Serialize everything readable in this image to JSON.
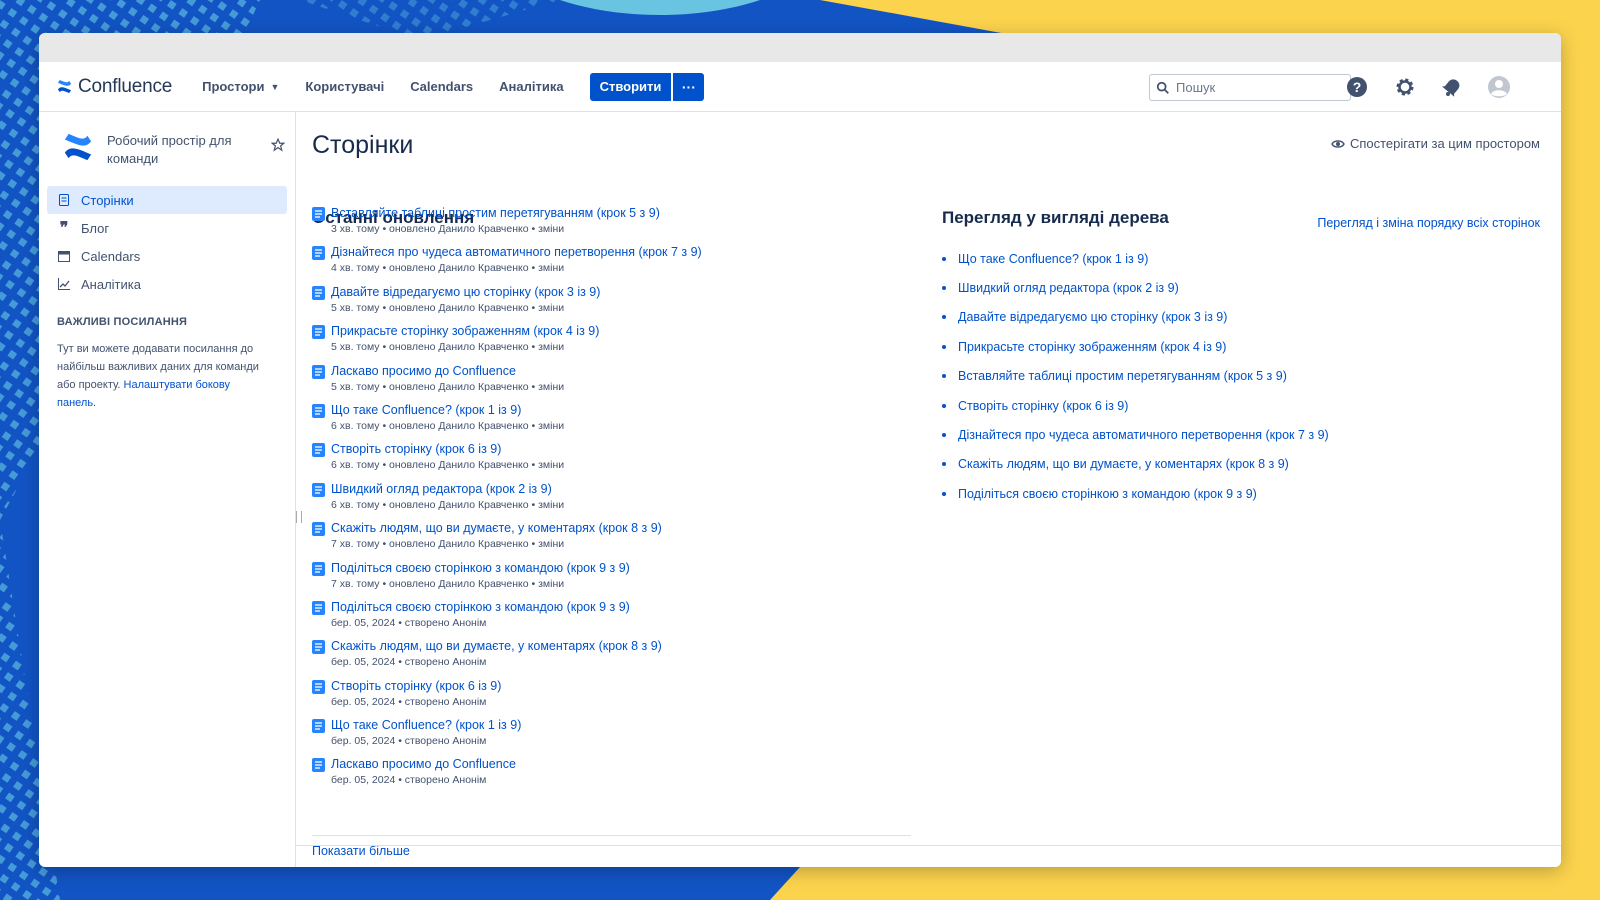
{
  "app": {
    "name": "Confluence",
    "accent_color": "#0052cc",
    "nav": {
      "spaces": "Простори",
      "people": "Користувачі",
      "calendars": "Calendars",
      "analytics": "Аналітика",
      "create": "Створити",
      "more": "···"
    },
    "search_placeholder": "Пошук",
    "icons": [
      "help-icon",
      "settings-icon",
      "notifications-icon",
      "user-avatar-icon"
    ]
  },
  "sidebar": {
    "space_name": "Робочий простір для команди",
    "items": [
      {
        "label": "Сторінки",
        "icon": "page-icon",
        "active": true
      },
      {
        "label": "Блог",
        "icon": "quote-icon",
        "active": false
      },
      {
        "label": "Calendars",
        "icon": "calendar-icon",
        "active": false
      },
      {
        "label": "Аналітика",
        "icon": "chart-icon",
        "active": false
      }
    ],
    "links_title": "ВАЖЛИВІ ПОСИЛАННЯ",
    "links_text": "Тут ви можете додавати посилання до найбільш важливих даних для команди або проекту.",
    "links_action": "Налаштувати бокову панель."
  },
  "main": {
    "title": "Сторінки",
    "watch_label": "Спостерігати за цим простором",
    "recent_title": "Останні оновлення",
    "tree_title": "Перегляд у вигляді дерева",
    "tree_all_link": "Перегляд і зміна порядку всіх сторінок",
    "show_more": "Показати більше",
    "recent": [
      {
        "title": "Вставляйте таблиці простим перетягуванням (крок 5 з 9)",
        "meta": "3 хв. тому • оновлено Данило Кравченко • зміни"
      },
      {
        "title": "Дізнайтеся про чудеса автоматичного перетворення (крок 7 з 9)",
        "meta": "4 хв. тому • оновлено Данило Кравченко • зміни"
      },
      {
        "title": "Давайте відредагуємо цю сторінку (крок 3 із 9)",
        "meta": "5 хв. тому • оновлено Данило Кравченко • зміни"
      },
      {
        "title": "Прикрасьте сторінку зображенням (крок 4 із 9)",
        "meta": "5 хв. тому • оновлено Данило Кравченко • зміни"
      },
      {
        "title": "Ласкаво просимо до Confluence",
        "meta": "5 хв. тому • оновлено Данило Кравченко • зміни"
      },
      {
        "title": "Що таке Confluence? (крок 1 із 9)",
        "meta": "6 хв. тому • оновлено Данило Кравченко • зміни"
      },
      {
        "title": "Створіть сторінку (крок 6 із 9)",
        "meta": "6 хв. тому • оновлено Данило Кравченко • зміни"
      },
      {
        "title": "Швидкий огляд редактора (крок 2 із 9)",
        "meta": "6 хв. тому • оновлено Данило Кравченко • зміни"
      },
      {
        "title": "Скажіть людям, що ви думаєте, у коментарях (крок 8 з 9)",
        "meta": "7 хв. тому • оновлено Данило Кравченко • зміни"
      },
      {
        "title": "Поділіться своєю сторінкою з командою (крок 9 з 9)",
        "meta": "7 хв. тому • оновлено Данило Кравченко • зміни"
      },
      {
        "title": "Поділіться своєю сторінкою з командою (крок 9 з 9)",
        "meta": "бер. 05, 2024 • створено Анонім"
      },
      {
        "title": "Скажіть людям, що ви думаєте, у коментарях (крок 8 з 9)",
        "meta": "бер. 05, 2024 • створено Анонім"
      },
      {
        "title": "Створіть сторінку (крок 6 із 9)",
        "meta": "бер. 05, 2024 • створено Анонім"
      },
      {
        "title": "Що таке Confluence? (крок 1 із 9)",
        "meta": "бер. 05, 2024 • створено Анонім"
      },
      {
        "title": "Ласкаво просимо до Confluence",
        "meta": "бер. 05, 2024 • створено Анонім"
      }
    ],
    "tree": [
      "Що таке Confluence? (крок 1 із 9)",
      "Швидкий огляд редактора (крок 2 із 9)",
      "Давайте відредагуємо цю сторінку (крок 3 із 9)",
      "Прикрасьте сторінку зображенням (крок 4 із 9)",
      "Вставляйте таблиці простим перетягуванням (крок 5 з 9)",
      "Створіть сторінку (крок 6 із 9)",
      "Дізнайтеся про чудеса автоматичного перетворення (крок 7 з 9)",
      "Скажіть людям, що ви думаєте, у коментарях (крок 8 з 9)",
      "Поділіться своєю сторінкою з командою (крок 9 з 9)"
    ]
  }
}
